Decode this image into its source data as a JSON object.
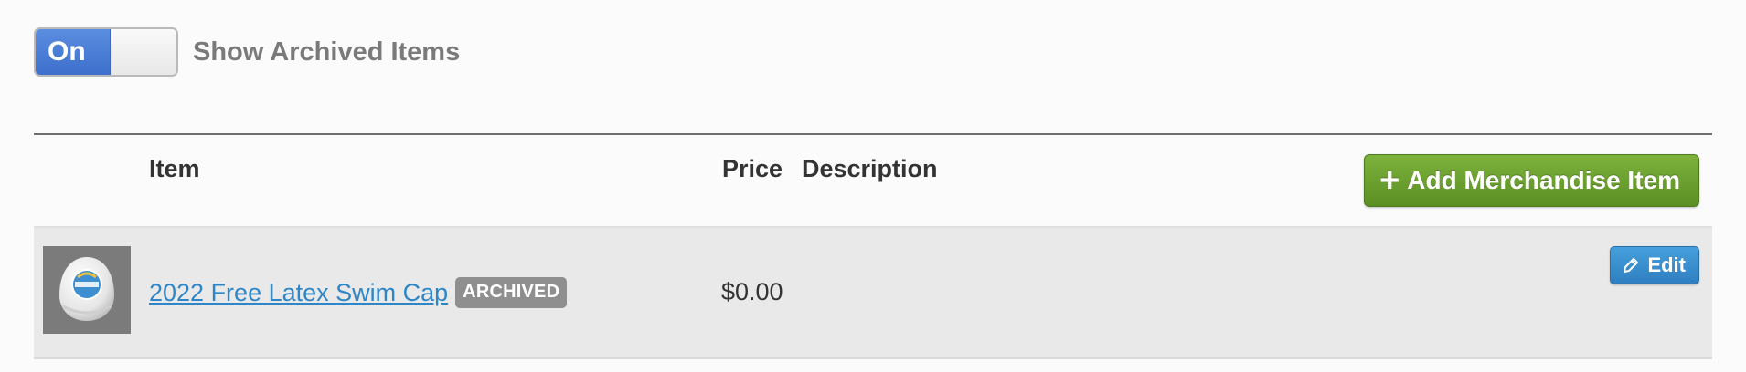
{
  "archive_toggle": {
    "state_label": "On",
    "label": "Show Archived Items"
  },
  "table": {
    "headers": {
      "item": "Item",
      "price": "Price",
      "description": "Description"
    },
    "add_button_label": "Add Merchandise Item",
    "rows": [
      {
        "name": "2022 Free Latex Swim Cap",
        "badge": "ARCHIVED",
        "price": "$0.00",
        "description": "",
        "edit_label": "Edit",
        "thumbnail_icon": "swim-cap-thumbnail"
      }
    ]
  },
  "colors": {
    "toggle_on": "#4a7fd6",
    "add_button": "#6b9f2e",
    "edit_button": "#3a8fcf",
    "link": "#2f86c6",
    "badge": "#8f8f8f"
  }
}
